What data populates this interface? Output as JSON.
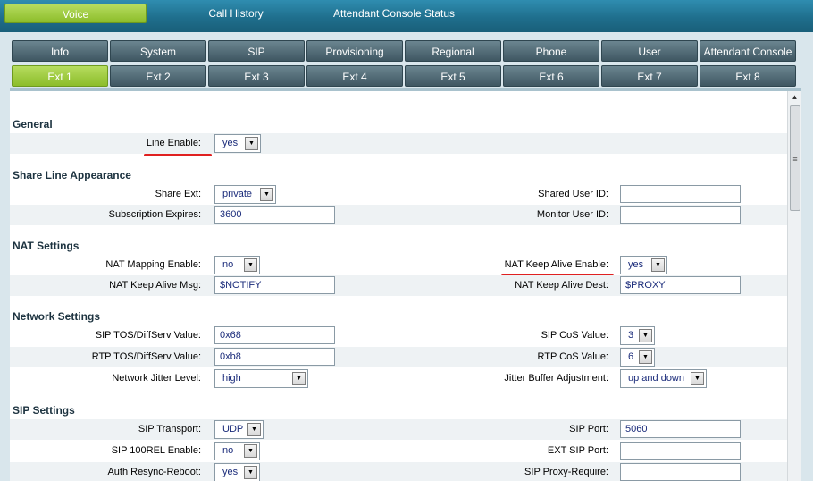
{
  "top_nav": [
    "Voice",
    "Call History",
    "Attendant Console Status"
  ],
  "main_tabs": [
    "Info",
    "System",
    "SIP",
    "Provisioning",
    "Regional",
    "Phone",
    "User",
    "Attendant Console"
  ],
  "ext_tabs": [
    "Ext 1",
    "Ext 2",
    "Ext 3",
    "Ext 4",
    "Ext 5",
    "Ext 6",
    "Ext 7",
    "Ext 8"
  ],
  "general": {
    "title": "General",
    "line_enable_label": "Line Enable:",
    "line_enable_value": "yes"
  },
  "share": {
    "title": "Share Line Appearance",
    "share_ext_label": "Share Ext:",
    "share_ext_value": "private",
    "shared_user_id_label": "Shared User ID:",
    "shared_user_id_value": "",
    "subscription_expires_label": "Subscription Expires:",
    "subscription_expires_value": "3600",
    "monitor_user_id_label": "Monitor User ID:",
    "monitor_user_id_value": ""
  },
  "nat": {
    "title": "NAT Settings",
    "mapping_enable_label": "NAT Mapping Enable:",
    "mapping_enable_value": "no",
    "keep_alive_enable_label": "NAT Keep Alive Enable:",
    "keep_alive_enable_value": "yes",
    "keep_alive_msg_label": "NAT Keep Alive Msg:",
    "keep_alive_msg_value": "$NOTIFY",
    "keep_alive_dest_label": "NAT Keep Alive Dest:",
    "keep_alive_dest_value": "$PROXY"
  },
  "network": {
    "title": "Network Settings",
    "sip_tos_label": "SIP TOS/DiffServ Value:",
    "sip_tos_value": "0x68",
    "sip_cos_label": "SIP CoS Value:",
    "sip_cos_value": "3",
    "rtp_tos_label": "RTP TOS/DiffServ Value:",
    "rtp_tos_value": "0xb8",
    "rtp_cos_label": "RTP CoS Value:",
    "rtp_cos_value": "6",
    "jitter_level_label": "Network Jitter Level:",
    "jitter_level_value": "high",
    "jitter_buffer_label": "Jitter Buffer Adjustment:",
    "jitter_buffer_value": "up and down"
  },
  "sip": {
    "title": "SIP Settings",
    "transport_label": "SIP Transport:",
    "transport_value": "UDP",
    "port_label": "SIP Port:",
    "port_value": "5060",
    "rel100_label": "SIP 100REL Enable:",
    "rel100_value": "no",
    "ext_sip_port_label": "EXT SIP Port:",
    "ext_sip_port_value": "",
    "auth_resync_label": "Auth Resync-Reboot:",
    "auth_resync_value": "yes",
    "proxy_require_label": "SIP Proxy-Require:",
    "proxy_require_value": ""
  },
  "colors": {
    "active_green": "#8cbd2a",
    "highlight_red": "#e02020",
    "topbar_blue": "#1f6f8d"
  }
}
